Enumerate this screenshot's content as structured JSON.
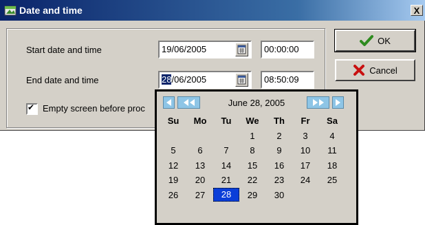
{
  "window": {
    "title": "Date and time",
    "close_label": "X"
  },
  "form": {
    "start_label": "Start date and time",
    "start_date": "19/06/2005",
    "start_time": "00:00:00",
    "end_label": "End date and time",
    "end_date_selected": "28",
    "end_date_rest": "/06/2005",
    "end_time": "08:50:09",
    "checkbox_label": "Empty screen before proc",
    "checkbox_mark": "✔"
  },
  "buttons": {
    "ok": "OK",
    "cancel": "Cancel"
  },
  "calendar": {
    "month_label": "June 28, 2005",
    "weekdays": [
      "Su",
      "Mo",
      "Tu",
      "We",
      "Th",
      "Fr",
      "Sa"
    ],
    "selected_day": "28",
    "weeks": [
      [
        "",
        "",
        "",
        "1",
        "2",
        "3",
        "4"
      ],
      [
        "5",
        "6",
        "7",
        "8",
        "9",
        "10",
        "11"
      ],
      [
        "12",
        "13",
        "14",
        "15",
        "16",
        "17",
        "18"
      ],
      [
        "19",
        "20",
        "21",
        "22",
        "23",
        "24",
        "25"
      ],
      [
        "26",
        "27",
        "28",
        "29",
        "30",
        "",
        ""
      ]
    ]
  },
  "colors": {
    "title_bar": "#0a246a",
    "selection": "#0a3ed8",
    "nav_buttons": "#8ec5e6",
    "ok_check": "#2e8b1f",
    "cancel_x": "#c81010"
  },
  "icons": {
    "title": "calendar-window-icon",
    "date_picker": "calendar-icon",
    "ok": "checkmark-icon",
    "cancel": "x-icon"
  }
}
